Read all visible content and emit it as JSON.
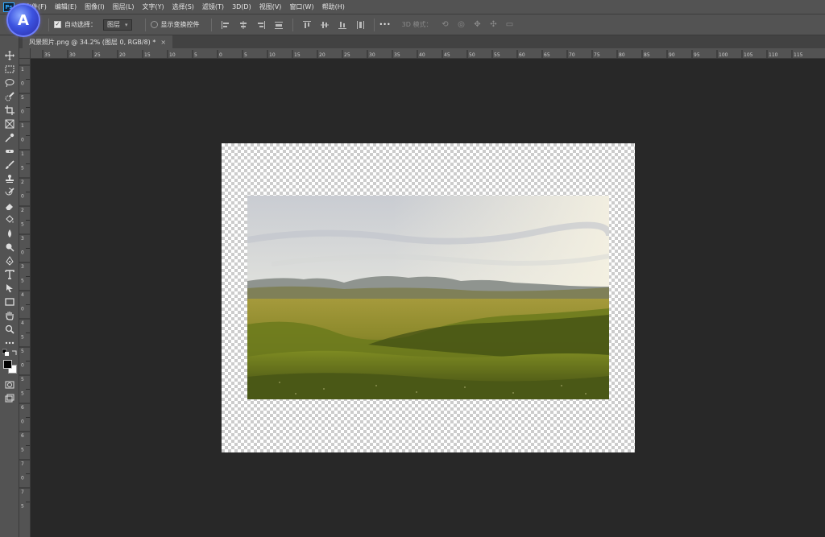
{
  "app": {
    "logo_text": "Ps",
    "badge_letter": "A"
  },
  "menu": [
    "文件(F)",
    "编辑(E)",
    "图像(I)",
    "图层(L)",
    "文字(Y)",
    "选择(S)",
    "滤镜(T)",
    "3D(D)",
    "视图(V)",
    "窗口(W)",
    "帮助(H)"
  ],
  "options": {
    "auto_select_label": "自动选择：",
    "layer_dropdown": "图层",
    "show_transform_label": "显示变换控件",
    "more_label": "•••",
    "mode_3d_label": "3D 模式："
  },
  "document": {
    "tab_title": "风景照片.png @ 34.2% (图层 0, RGB/8) *",
    "close_glyph": "×"
  },
  "ruler": {
    "h_labels": [
      "35",
      "30",
      "25",
      "20",
      "15",
      "10",
      "5",
      "0",
      "5",
      "10",
      "15",
      "20",
      "25",
      "30",
      "35",
      "40",
      "45",
      "50",
      "55",
      "60",
      "65",
      "70",
      "75",
      "80",
      "85",
      "90",
      "95",
      "100",
      "105",
      "110",
      "115"
    ],
    "v_labels": [
      "1",
      "0",
      "5",
      "0",
      "1",
      "0",
      "1",
      "5",
      "2",
      "0",
      "2",
      "5",
      "3",
      "0",
      "3",
      "5",
      "4",
      "0",
      "4",
      "5",
      "5",
      "0",
      "5",
      "5",
      "6",
      "0",
      "6",
      "5",
      "7",
      "0",
      "7",
      "5"
    ]
  },
  "tools": [
    "move",
    "marquee",
    "lasso",
    "quick-select",
    "crop",
    "frame",
    "eyedropper",
    "spot-heal",
    "brush",
    "stamp",
    "history-brush",
    "eraser",
    "bucket",
    "blur",
    "dodge",
    "pen",
    "type",
    "path-select",
    "rectangle",
    "hand",
    "zoom",
    "more"
  ],
  "colors": {
    "foreground": "#000000",
    "background": "#ffffff",
    "ui_dark": "#535353",
    "canvas_bg": "#282828"
  }
}
